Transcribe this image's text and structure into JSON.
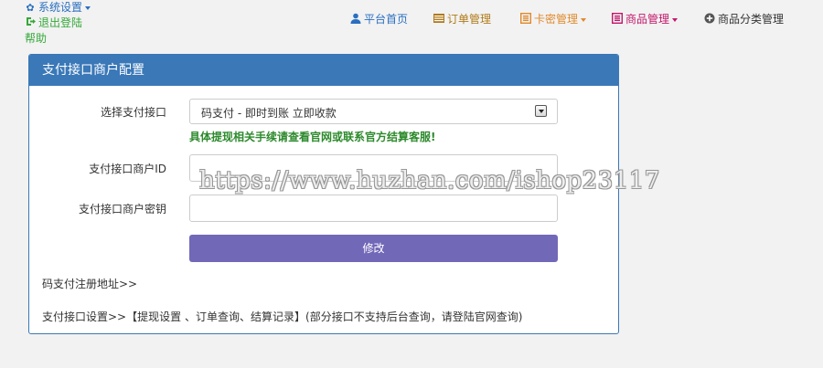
{
  "top_links": {
    "settings": "系统设置",
    "logout": "退出登陆",
    "help": "帮助"
  },
  "nav": {
    "home": "平台首页",
    "orders": "订单管理",
    "cards": "卡密管理",
    "goods": "商品管理",
    "categories": "商品分类管理"
  },
  "panel": {
    "title": "支付接口商户配置",
    "select_label": "选择支付接口",
    "select_value": "码支付 - 即时到账 立即收款",
    "hint": "具体提现相关手续请查看官网或联系官方结算客服!",
    "merchant_id_label": "支付接口商户ID",
    "merchant_key_label": "支付接口商户密钥",
    "merchant_id_value": "",
    "merchant_key_value": "",
    "submit": "修改",
    "register_link": "码支付注册地址>>",
    "settings_prefix": "支付接口设置>>【",
    "settings_links": [
      "提现设置",
      "订单查询",
      "结算记录"
    ],
    "settings_suffix": "】(部分接口不支持后台查询，请登陆官网查询)"
  },
  "watermark": "https://www.huzhan.com/ishop23117",
  "colors": {
    "panel_header": "#3a78b8",
    "button": "#7268b8",
    "hint": "#2d8a2d",
    "link_blue": "#2a6fc0",
    "link_green": "#36a83a"
  },
  "icons": {
    "settings": "gear-icon",
    "logout": "logout-icon",
    "home": "user-icon",
    "orders": "list-icon",
    "cards": "card-icon",
    "goods": "box-icon",
    "categories": "plus-circle-icon"
  }
}
